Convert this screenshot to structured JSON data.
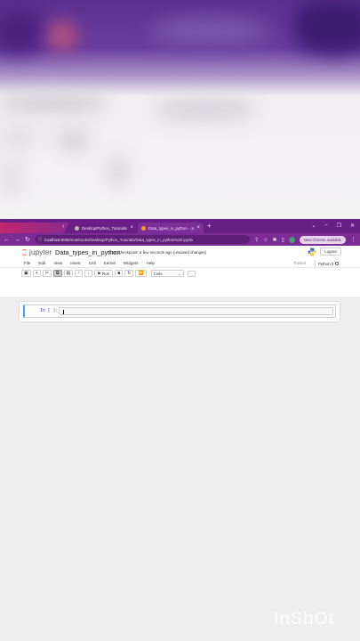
{
  "browser": {
    "tabs": [
      {
        "label": "Desktop/Python_Tutorials/",
        "active": false
      },
      {
        "label": "Data_types_in_python - Jupyte",
        "active": true
      }
    ],
    "url_host": "localhost",
    "url_path": ":8888/notebooks/Desktop/Python_Tutorials/Data_types_in_python%20.ipynb",
    "chrome_update_label": "New Chrome available",
    "accent_color": "#7b2c95"
  },
  "jupyter": {
    "logo_text": "jupyter",
    "notebook_title": "Data_types_in_python",
    "checkpoint": "Last Checkpoint: a few seconds ago",
    "unsaved": "(unsaved changes)",
    "logout_label": "Logout",
    "menu": [
      "File",
      "Edit",
      "View",
      "Insert",
      "Cell",
      "Kernel",
      "Widgets",
      "Help"
    ],
    "trusted_label": "Trusted",
    "kernel_label": "Python 3",
    "toolbar": {
      "run_label": "Run",
      "cell_type": "Code"
    },
    "cell": {
      "prompt": "In [ ]:"
    }
  },
  "watermark": "InShOt"
}
